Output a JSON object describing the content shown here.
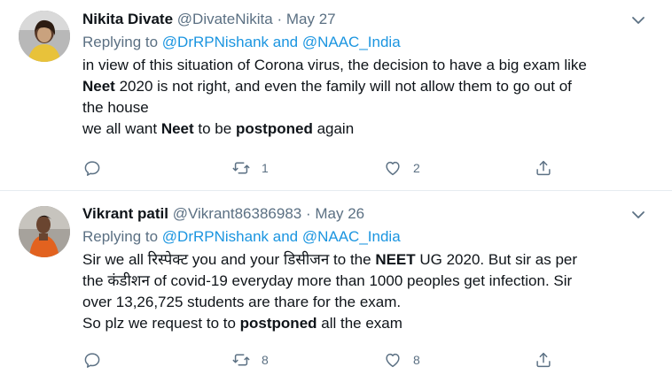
{
  "tweets": [
    {
      "name": "Nikita Divate",
      "handle": "@DivateNikita",
      "sep": "·",
      "date": "May 27",
      "replying_prefix": "Replying to",
      "replying_to": "@DrRPNishank and @NAAC_India",
      "body": {
        "line1": "in view of this situation of Corona virus, the decision to have a big exam like",
        "line2_bold": "Neet",
        "line2_rest": " 2020 is not right, and even the family will not allow them to go out of",
        "line3": "the house",
        "line4_a": "we all want ",
        "line4_b": "Neet",
        "line4_c": " to be ",
        "line4_d": "postponed",
        "line4_e": " again"
      },
      "actions": {
        "reply": "",
        "retweet": "1",
        "like": "2"
      }
    },
    {
      "name": "Vikrant patil",
      "handle": "@Vikrant86386983",
      "sep": "·",
      "date": "May 26",
      "replying_prefix": "Replying to",
      "replying_to": "@DrRPNishank and @NAAC_India",
      "body": {
        "line1_a": "Sir we all रिस्पेक्ट you and your डिसीजन to the ",
        "line1_b": "NEET",
        "line1_c": " UG 2020. But sir as per",
        "line2": "the कंडीशन of covid-19 everyday more than 1000 peoples get infection. Sir",
        "line3": "over 13,26,725 students are thare for the exam.",
        "line4_a": "So plz we request to to ",
        "line4_b": "postponed",
        "line4_c": " all the exam"
      },
      "actions": {
        "reply": "",
        "retweet": "8",
        "like": "8"
      }
    }
  ],
  "icons": [
    "chevron-down-icon",
    "reply-icon",
    "retweet-icon",
    "like-icon",
    "share-icon"
  ],
  "colors": {
    "link": "#1b95e0",
    "muted": "#5b7083",
    "text": "#0f1419",
    "divider": "#e6ecf0"
  }
}
